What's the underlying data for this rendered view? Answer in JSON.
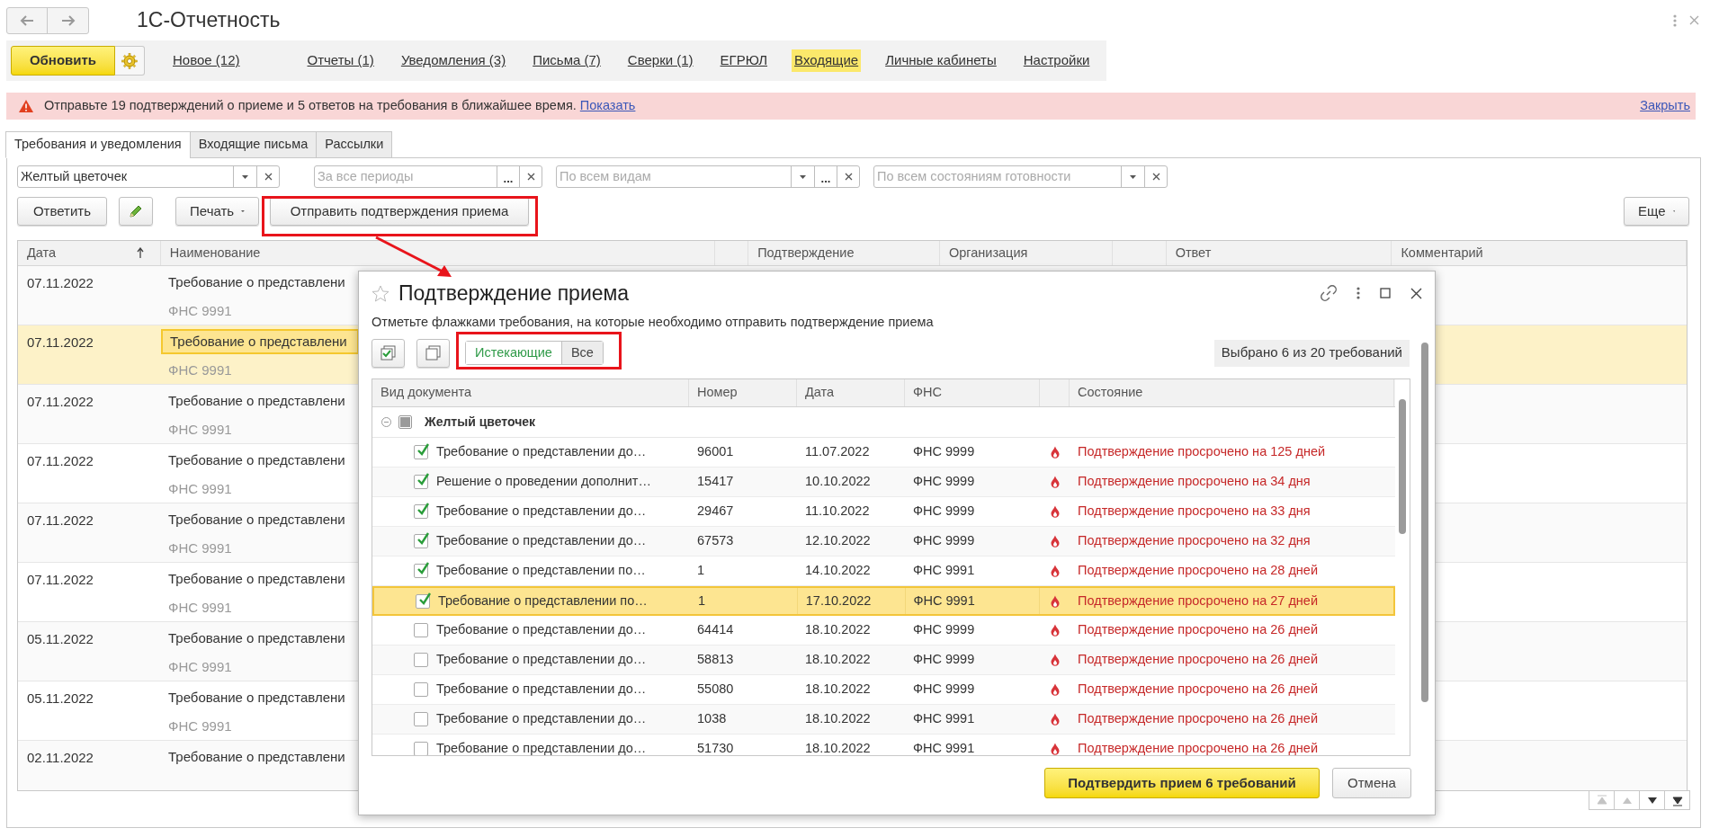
{
  "window": {
    "title": "1С-Отчетность"
  },
  "toolbar": {
    "refresh": "Обновить",
    "links": [
      {
        "label": "Новое (12)",
        "selected": false
      },
      {
        "label": "Отчеты (1)",
        "selected": false
      },
      {
        "label": "Уведомления (3)",
        "selected": false
      },
      {
        "label": "Письма (7)",
        "selected": false
      },
      {
        "label": "Сверки (1)",
        "selected": false
      },
      {
        "label": "ЕГРЮЛ",
        "selected": false
      },
      {
        "label": "Входящие",
        "selected": true
      },
      {
        "label": "Личные кабинеты",
        "selected": false
      },
      {
        "label": "Настройки",
        "selected": false
      }
    ]
  },
  "alert": {
    "message": "Отправьте 19 подтверждений о приеме и 5 ответов на требования в ближайшее время.",
    "link": "Показать",
    "close": "Закрыть"
  },
  "tabs": [
    {
      "label": "Требования и уведомления",
      "selected": true
    },
    {
      "label": "Входящие письма",
      "selected": false
    },
    {
      "label": "Рассылки",
      "selected": false
    }
  ],
  "filters": [
    {
      "kind": "select",
      "value": "Желтый цветочек"
    },
    {
      "kind": "choose",
      "placeholder": "За все периоды",
      "choose_label": "..."
    },
    {
      "kind": "select_choose",
      "placeholder": "По всем видам",
      "choose_label": "..."
    },
    {
      "kind": "select",
      "placeholder": "По всем состояниям готовности"
    }
  ],
  "actions": {
    "reply": "Ответить",
    "print": "Печать",
    "send": "Отправить подтверждения приема",
    "more": "Еще"
  },
  "table": {
    "columns": [
      {
        "kind": "header",
        "label": "Дата",
        "sorted": true
      },
      {
        "kind": "header",
        "label": "Наименование"
      },
      {
        "kind": "spacer"
      },
      {
        "kind": "header",
        "label": "Подтверждение"
      },
      {
        "kind": "header",
        "label": "Организация"
      },
      {
        "kind": "spacer"
      },
      {
        "kind": "header",
        "label": "Ответ"
      },
      {
        "kind": "header",
        "label": "Комментарий"
      }
    ],
    "rows": [
      {
        "date": "07.11.2022",
        "name": "Требование о представлени",
        "org": "ФНС 9991",
        "selected": false
      },
      {
        "date": "07.11.2022",
        "name": "Требование о представлени",
        "org": "ФНС 9991",
        "selected": true
      },
      {
        "date": "07.11.2022",
        "name": "Требование о представлени",
        "org": "ФНС 9991",
        "selected": false
      },
      {
        "date": "07.11.2022",
        "name": "Требование о представлени",
        "org": "ФНС 9991",
        "selected": false
      },
      {
        "date": "07.11.2022",
        "name": "Требование о представлени",
        "org": "ФНС 9991",
        "selected": false
      },
      {
        "date": "07.11.2022",
        "name": "Требование о представлени",
        "org": "ФНС 9991",
        "selected": false
      },
      {
        "date": "05.11.2022",
        "name": "Требование о представлени",
        "org": "ФНС 9991",
        "selected": false
      },
      {
        "date": "05.11.2022",
        "name": "Требование о представлени",
        "org": "ФНС 9991",
        "selected": false
      },
      {
        "date": "02.11.2022",
        "name": "Требование о представлени",
        "selected": false
      }
    ]
  },
  "pager": [
    {
      "kind": "first",
      "disabled": true
    },
    {
      "kind": "up",
      "disabled": true
    },
    {
      "kind": "down",
      "disabled": false
    },
    {
      "kind": "last",
      "disabled": false
    }
  ],
  "dialog": {
    "title": "Подтверждение приема",
    "instruction": "Отметьте флажками требования, на которые необходимо отправить подтверждение приема",
    "filter": [
      {
        "label": "Истекающие",
        "selected": true
      },
      {
        "label": "Все",
        "selected": false
      }
    ],
    "counter": "Выбрано 6 из 20 требований",
    "columns": [
      "Вид документа",
      "Номер",
      "Дата",
      "ФНС",
      "Состояние"
    ],
    "group": {
      "name": "Желтый цветочек",
      "expanded": true,
      "indeterminate": true
    },
    "rows": [
      {
        "doc": "Требование о представлении до…",
        "number": "96001",
        "date": "11.07.2022",
        "ifns": "ФНС 9999",
        "status": "Подтверждение просрочено на 125 дней",
        "checked": true,
        "selected": false
      },
      {
        "doc": "Решение о проведении дополнит…",
        "number": "15417",
        "date": "10.10.2022",
        "ifns": "ФНС 9999",
        "status": "Подтверждение просрочено на 34 дня",
        "checked": true,
        "selected": false
      },
      {
        "doc": "Требование о представлении до…",
        "number": "29467",
        "date": "11.10.2022",
        "ifns": "ФНС 9999",
        "status": "Подтверждение просрочено на 33 дня",
        "checked": true,
        "selected": false
      },
      {
        "doc": "Требование о представлении до…",
        "number": "67573",
        "date": "12.10.2022",
        "ifns": "ФНС 9999",
        "status": "Подтверждение просрочено на 32 дня",
        "checked": true,
        "selected": false
      },
      {
        "doc": "Требование о представлении по…",
        "number": "1",
        "date": "14.10.2022",
        "ifns": "ФНС 9991",
        "status": "Подтверждение просрочено на 28 дней",
        "checked": true,
        "selected": false
      },
      {
        "doc": "Требование о представлении по…",
        "number": "1",
        "date": "17.10.2022",
        "ifns": "ФНС 9991",
        "status": "Подтверждение просрочено на 27 дней",
        "checked": true,
        "selected": true
      },
      {
        "doc": "Требование о представлении до…",
        "number": "64414",
        "date": "18.10.2022",
        "ifns": "ФНС 9999",
        "status": "Подтверждение просрочено на 26 дней",
        "checked": false,
        "selected": false
      },
      {
        "doc": "Требование о представлении до…",
        "number": "58813",
        "date": "18.10.2022",
        "ifns": "ФНС 9999",
        "status": "Подтверждение просрочено на 26 дней",
        "checked": false,
        "selected": false
      },
      {
        "doc": "Требование о представлении до…",
        "number": "55080",
        "date": "18.10.2022",
        "ifns": "ФНС 9999",
        "status": "Подтверждение просрочено на 26 дней",
        "checked": false,
        "selected": false
      },
      {
        "doc": "Требование о представлении до…",
        "number": "1038",
        "date": "18.10.2022",
        "ifns": "ФНС 9991",
        "status": "Подтверждение просрочено на 26 дней",
        "checked": false,
        "selected": false
      },
      {
        "doc": "Требование о представлении до…",
        "number": "51730",
        "date": "18.10.2022",
        "ifns": "ФНС 9991",
        "status": "Подтверждение просрочено на 26 дней",
        "checked": false,
        "selected": false
      }
    ],
    "confirm": "Подтвердить прием 6 требований",
    "cancel": "Отмена"
  }
}
